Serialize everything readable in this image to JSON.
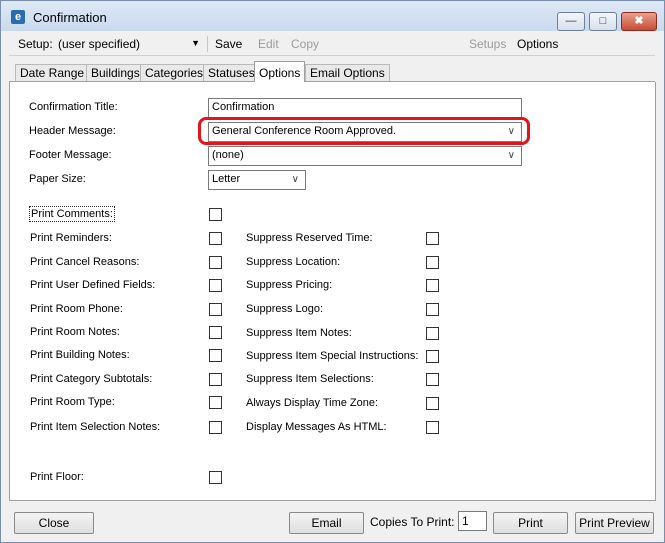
{
  "window": {
    "title": "Confirmation",
    "minimize": "—",
    "maximize": "□",
    "close": "✖"
  },
  "toolbar": {
    "setup_label": "Setup:",
    "setup_value": "(user specified)",
    "save": "Save",
    "edit": "Edit",
    "copy": "Copy",
    "setups": "Setups",
    "options": "Options"
  },
  "tabs": [
    "Date Range",
    "Buildings",
    "Categories",
    "Statuses",
    "Options",
    "Email Options"
  ],
  "form": {
    "confirmation_title": {
      "label": "Confirmation Title:",
      "value": "Confirmation"
    },
    "header_message": {
      "label": "Header Message:",
      "value": "General Conference Room Approved."
    },
    "footer_message": {
      "label": "Footer Message:",
      "value": "(none)"
    },
    "paper_size": {
      "label": "Paper Size:",
      "value": "Letter"
    }
  },
  "left_options": [
    "Print Comments:",
    "Print Reminders:",
    "Print Cancel Reasons:",
    "Print User Defined Fields:",
    "Print Room Phone:",
    "Print Room Notes:",
    "Print Building Notes:",
    "Print Category Subtotals:",
    "Print Room Type:",
    "Print Item Selection Notes:",
    "Print Floor:"
  ],
  "right_options": [
    "Suppress Reserved Time:",
    "Suppress Location:",
    "Suppress Pricing:",
    "Suppress Logo:",
    "Suppress Item Notes:",
    "Suppress Item Special Instructions:",
    "Suppress Item Selections:",
    "Always Display Time Zone:",
    "Display Messages As HTML:"
  ],
  "footer": {
    "close": "Close",
    "email": "Email",
    "copies_label": "Copies To Print:",
    "copies_value": "1",
    "print": "Print",
    "print_preview": "Print Preview"
  },
  "icons": {
    "dropdown": "∨",
    "app": "e"
  },
  "colors": {
    "highlight": "#e3141c"
  }
}
